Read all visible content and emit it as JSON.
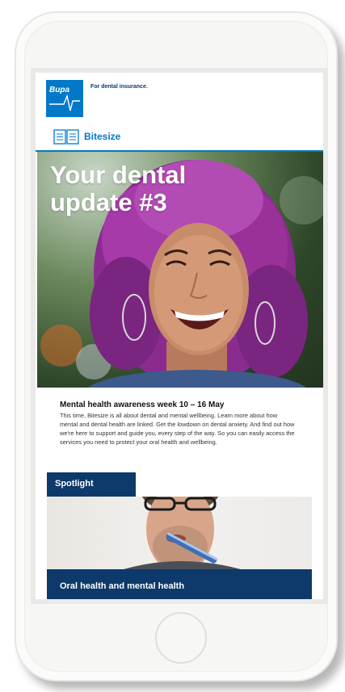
{
  "header": {
    "brand": "Bupa",
    "tagline": "For dental insurance.",
    "section_label": "Bitesize"
  },
  "hero": {
    "title": "Your dental update #3"
  },
  "intro": {
    "heading": "Mental health awareness week 10 – 16 May",
    "body": "This time, Bitesize is all about dental and mental wellbeing. Learn more about how mental and dental health are linked. Get the lowdown on dental anxiety. And find out how we're here to support and guide you, every step of the way. So you can easily access the services you need to protect your oral health and wellbeing."
  },
  "spotlight": {
    "label": "Spotlight",
    "article_title": "Oral health and mental health"
  },
  "colors": {
    "brand_blue": "#0079c8",
    "navy": "#0d3a6a"
  }
}
